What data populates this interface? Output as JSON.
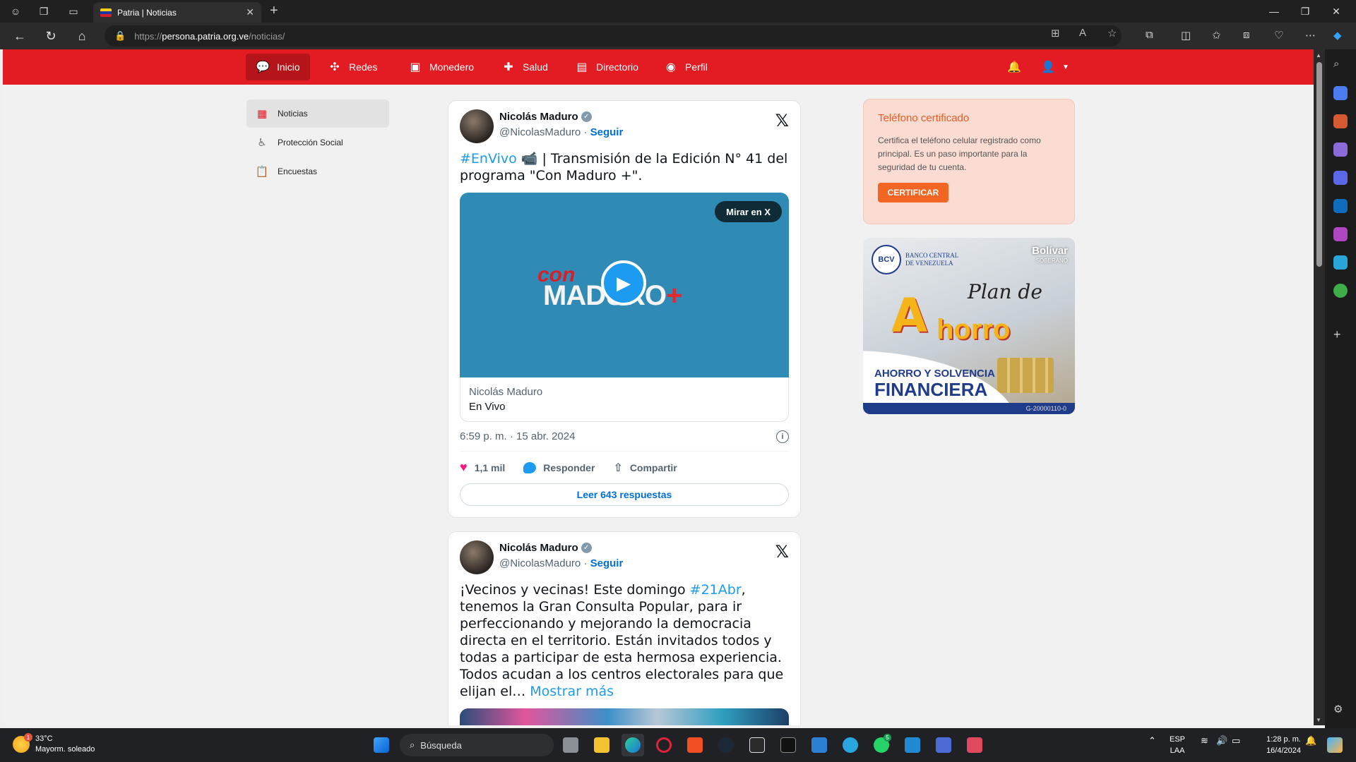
{
  "browser": {
    "tab_title": "Patria | Noticias",
    "url_dim_prefix": "https://",
    "url_host": "persona.patria.org.ve",
    "url_path": "/noticias/"
  },
  "site_nav": {
    "items": [
      {
        "label": "Inicio",
        "icon": "chat-icon"
      },
      {
        "label": "Redes",
        "icon": "network-icon"
      },
      {
        "label": "Monedero",
        "icon": "wallet-icon"
      },
      {
        "label": "Salud",
        "icon": "health-cross-icon"
      },
      {
        "label": "Directorio",
        "icon": "directory-icon"
      },
      {
        "label": "Perfil",
        "icon": "user-circle-icon"
      }
    ]
  },
  "side_menu": {
    "items": [
      {
        "label": "Noticias",
        "icon": "news-icon"
      },
      {
        "label": "Protección Social",
        "icon": "social-protection-icon"
      },
      {
        "label": "Encuestas",
        "icon": "clipboard-icon"
      }
    ]
  },
  "tweet1": {
    "name": "Nicolás Maduro",
    "handle": "@NicolasMaduro",
    "separator": " · ",
    "follow": "Seguir",
    "hashtag": "#EnVivo",
    "text": " 📹 | Transmisión de la Edición N° 41 del programa \"Con Maduro +\".",
    "media_button": "Mirar en X",
    "media_logo_top": "con",
    "media_logo_main": "MADURO",
    "media_logo_plus": "+",
    "media_caption_title": "Nicolás Maduro",
    "media_caption_sub": "En Vivo",
    "time": "6:59 p. m. · 15 abr. 2024",
    "likes": "1,1 mil",
    "reply": "Responder",
    "share": "Compartir",
    "read_replies": "Leer 643 respuestas"
  },
  "tweet2": {
    "name": "Nicolás Maduro",
    "handle": "@NicolasMaduro",
    "separator": " · ",
    "follow": "Seguir",
    "text_a": "¡Vecinos y vecinas! Este domingo ",
    "hashtag": "#21Abr",
    "text_b": ", tenemos la Gran Consulta Popular, para ir perfeccionando y mejorando la democracia directa en el territorio. Están invitados todos y todas a participar de esta hermosa experiencia. Todos acudan a los centros electorales para que elijan el… ",
    "more": "Mostrar más"
  },
  "cert_card": {
    "title": "Teléfono certificado",
    "body": "Certifica el teléfono celular registrado como principal. Es un paso importante para la seguridad de tu cuenta.",
    "button": "CERTIFICAR"
  },
  "banner": {
    "bcv_mark": "BCV",
    "bank_line1": "BANCO CENTRAL",
    "bank_line2": "DE VENEZUELA",
    "brand": "Bolívar",
    "brand_sub": "SOBERANO",
    "big_letter": "A",
    "plan": "Plan de",
    "ahorro": "horro",
    "tag1": "AHORRO Y SOLVENCIA",
    "tag2": "FINANCIERA",
    "rif": "G-20000110-0"
  },
  "taskbar": {
    "temp": "33°C",
    "weather": "Mayorm. soleado",
    "weather_badge": "1",
    "search": "Búsqueda",
    "lang1": "ESP",
    "lang2": "LAA",
    "time": "1:28 p. m.",
    "date": "16/4/2024",
    "whatsapp_badge": "5"
  },
  "colors": {
    "brand_red": "#e31b23",
    "link_blue": "#1d9bf0",
    "cert_orange": "#f26522"
  }
}
